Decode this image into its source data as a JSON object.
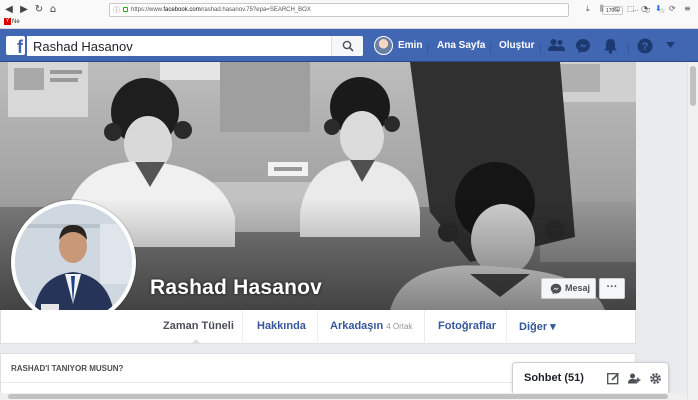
{
  "browser": {
    "url_prefix": "https://www.",
    "url_domain": "facebook.com",
    "url_path": "/rashad.hasanov.75?epa=SEARCH_BOX",
    "zoom": "170%",
    "bookmark": "Ne"
  },
  "topbar": {
    "search_value": "Rashad Hasanov",
    "user_name": "Emin",
    "home_label": "Ana Sayfa",
    "create_label": "Oluştur"
  },
  "profile": {
    "name": "Rashad Hasanov",
    "message_label": "Mesaj",
    "more_label": "···"
  },
  "tabs": [
    {
      "label": "Zaman Tüneli"
    },
    {
      "label": "Hakkında"
    },
    {
      "label": "Arkadaşın",
      "count": "4 Ortak"
    },
    {
      "label": "Fotoğraflar"
    },
    {
      "label": "Diğer ▾"
    }
  ],
  "card": {
    "title": "RASHAD'I TANIYOR MUSUN?"
  },
  "chat": {
    "label": "Sohbet (51)"
  },
  "colors": {
    "fb_blue": "#4267b2",
    "link_blue": "#365899"
  }
}
